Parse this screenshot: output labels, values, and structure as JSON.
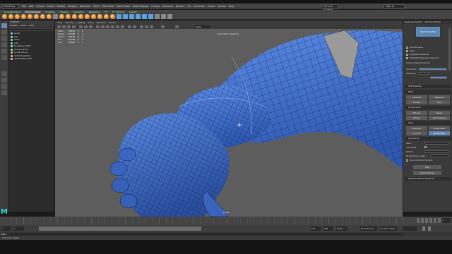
{
  "menubar": {
    "workspace_value": "Modeling",
    "menus": [
      "File",
      "Edit",
      "Create",
      "Select",
      "Modify",
      "Display",
      "Windows",
      "Mesh",
      "Edit Mesh",
      "Mesh Tools",
      "Mesh Display",
      "Curves",
      "Surfaces",
      "Deform",
      "UV",
      "Generate",
      "Cache",
      "Arnold",
      "Help"
    ],
    "live_surface": "No Live Surface",
    "sign_in": "Sign In"
  },
  "shelf": {
    "tabs": [
      "Curves/Surfaces",
      "Poly Modeling",
      "Sculpting",
      "Rigging",
      "Animation",
      "Rendering",
      "FX",
      "FX Caching",
      "Custom"
    ],
    "active_tab_index": 1
  },
  "outliner": {
    "title": "Outliner",
    "menus": [
      "Display",
      "Show",
      "Help"
    ],
    "items": [
      "persp",
      "top",
      "front",
      "side",
      "BodyMesh_GEO",
      "polySurface1",
      "polySurface2",
      "defaultLightSet",
      "defaultObjectSet"
    ]
  },
  "viewport": {
    "panel_menus": [
      "View",
      "Shading",
      "Lighting",
      "Show",
      "Renderer",
      "Panels"
    ],
    "camera_label": "persp",
    "hud_rows": [
      {
        "label": "Verts:",
        "v1": "86694",
        "v2": "0",
        "v3": "0"
      },
      {
        "label": "Edges:",
        "v1": "173386",
        "v2": "0",
        "v3": "0"
      },
      {
        "label": "Faces:",
        "v1": "86694",
        "v2": "0",
        "v3": "0"
      },
      {
        "label": "Tris:",
        "v1": "173388",
        "v2": "0",
        "v3": "0"
      },
      {
        "label": "UVs:",
        "v1": "89806",
        "v2": "0",
        "v3": "0"
      }
    ],
    "symmetry_label": "Symmetry: Object X",
    "persp_label": "persp"
  },
  "modeling_toolkit": {
    "tabs": [
      "Modeling Toolkit",
      "Attribute Editor"
    ],
    "object_mode": "Object Selection",
    "options": [
      "Pick/Marquee",
      "Drag",
      "Highlight Backfaces",
      "Highlight Nearest Component"
    ],
    "camera_based": "Camera Based Selection",
    "symmetry_label": "Symmetry:",
    "symmetry_value": "Object X",
    "tolerance_label": "Tolerance:",
    "soft_selection": "Soft Selection",
    "mesh_section": "Mesh",
    "mesh_buttons": [
      "Combine",
      "Separate",
      "Smooth",
      "Bool"
    ],
    "components_section": "Components",
    "component_buttons": [
      "Extrude",
      "Bevel",
      "Bridge",
      "Add Divisions"
    ],
    "tools_section": "Tools",
    "tool_buttons": [
      "Multi-Cut",
      "Target Weld",
      "Connect",
      "Quad Draw"
    ],
    "quad_draw_section": "Quad Draw",
    "quad_draw_fields": [
      "Relax",
      "Auto Weld",
      "Extend",
      "Target Edge Length"
    ],
    "live_constraint": "Live Constraint Surface",
    "buttons": [
      "Help",
      "Reset Settings"
    ],
    "keyboard_section": "Keyboard/Mouse Shortcuts"
  },
  "timeline": {
    "start": "1",
    "end": "120",
    "range_start": "1",
    "range_end": "120",
    "anim_end": "200",
    "fps": "24 fps",
    "no_char_set": "No Character Set",
    "no_anim_layer": "No Anim Layer",
    "current_frame": "1"
  },
  "command_line": {
    "label": "MEL",
    "help": "Select an object"
  },
  "colors": {
    "mesh_blue": "#3f6fcc",
    "accent": "#5c87b5",
    "maya_teal": "#2fd0d0"
  }
}
